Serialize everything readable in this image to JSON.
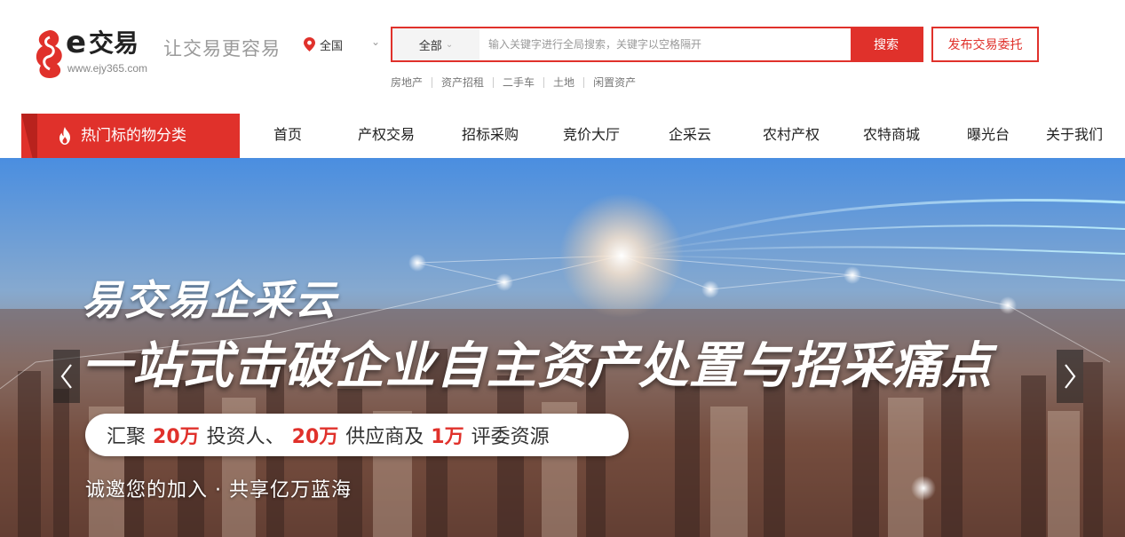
{
  "header": {
    "logo": {
      "e": "e",
      "name": "交易",
      "url": "www.ejy365.com"
    },
    "slogan": "让交易更容易",
    "region": {
      "icon": "location-pin-icon",
      "label": "全国"
    },
    "search": {
      "category": "全部",
      "placeholder": "输入关键字进行全局搜索，关键字以空格隔开",
      "button": "搜索"
    },
    "publish_button": "发布交易委托",
    "hot_tags": [
      "房地产",
      "资产招租",
      "二手车",
      "土地",
      "闲置资产"
    ]
  },
  "nav": {
    "category_button": "热门标的物分类",
    "items": [
      "首页",
      "产权交易",
      "招标采购",
      "竞价大厅",
      "企采云",
      "农村产权",
      "农特商城",
      "曝光台",
      "关于我们"
    ]
  },
  "banner": {
    "title": "易交易企采云",
    "subtitle": "一站式击破企业自主资产处置与招采痛点",
    "pill": {
      "p1": "汇聚",
      "n1": "20万",
      "p2": "投资人、",
      "n2": "20万",
      "p3": "供应商及",
      "n3": "1万",
      "p4": "评委资源"
    },
    "footer": "诚邀您的加入 · 共享亿万蓝海"
  },
  "colors": {
    "accent": "#e0312b",
    "accent_dark": "#b8221d",
    "sky_top": "#5a9be8",
    "city_bottom": "#7a4a36"
  }
}
